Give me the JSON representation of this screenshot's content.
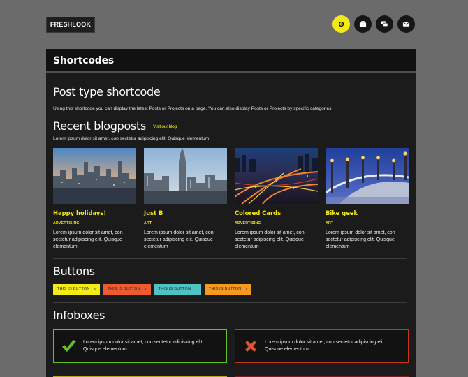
{
  "site": {
    "logo": "FRESHLOOK"
  },
  "top_icons": [
    {
      "name": "gear-icon",
      "active": true
    },
    {
      "name": "briefcase-icon",
      "active": false
    },
    {
      "name": "chat-icon",
      "active": false
    },
    {
      "name": "mail-icon",
      "active": false
    }
  ],
  "page": {
    "title": "Shortcodes"
  },
  "post_type": {
    "heading": "Post type shortcode",
    "description": "Using this shortcode you can display the latest Posts or Projects on a page. You can also display Posts or Projects by specific categories."
  },
  "recent": {
    "heading": "Recent blogposts",
    "link": "Visit our blog",
    "intro": "Lorem ipsum dolor sit amet, con sectetur adipiscing elit. Quisque elementum"
  },
  "posts": [
    {
      "title": "Happy holidays!",
      "category": "ADVERTISING",
      "excerpt": "Lorem ipsum dolor sit amet, con sectetur adipiscing elit. Quisque elementum",
      "image": "city-skyline-dusk"
    },
    {
      "title": "Just B",
      "category": "ART",
      "excerpt": "Lorem ipsum dolor sit amet, con sectetur adipiscing elit. Quisque elementum",
      "image": "skyscraper-tower"
    },
    {
      "title": "Colored Cards",
      "category": "ADVERTISING",
      "excerpt": "Lorem ipsum dolor sit amet, con sectetur adipiscing elit. Quisque elementum",
      "image": "city-lights-night"
    },
    {
      "title": "Bike geek",
      "category": "ART",
      "excerpt": "Lorem ipsum dolor sit amet, con sectetur adipiscing elit. Quisque elementum",
      "image": "bridge-lamps"
    }
  ],
  "buttons_section": {
    "heading": "Buttons",
    "buttons": [
      {
        "label": "THIS IS BUTTON",
        "color": "#f3ea16"
      },
      {
        "label": "THIS IS BUTTON",
        "color": "#ee5b33"
      },
      {
        "label": "THIS IS BUTTON",
        "color": "#4fc3c1"
      },
      {
        "label": "THIS IS BUTTON",
        "color": "#f59a1f"
      }
    ]
  },
  "infoboxes_section": {
    "heading": "Infoboxes",
    "boxes": [
      {
        "type": "success",
        "icon": "checkmark-icon",
        "border": "#5fc229",
        "text": "Lorem ipsum dolor sit amet, con sectetur adipiscing elit. Quisque elementum"
      },
      {
        "type": "error",
        "icon": "cross-icon",
        "border": "#c9331c",
        "text": "Lorem ipsum dolor sit amet, con sectetur adipiscing elit. Quisque elementum"
      }
    ]
  },
  "colors": {
    "accent": "#f3ea16",
    "background": "#6b6b6b",
    "panel": "#1b1b1b"
  }
}
